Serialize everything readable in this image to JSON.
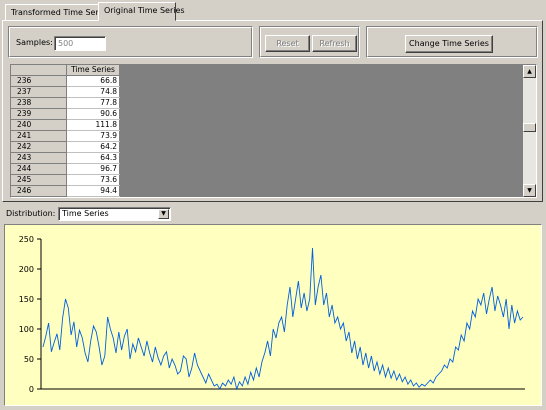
{
  "tabs": [
    {
      "label": "Transformed Time Series",
      "active": false
    },
    {
      "label": "Original Time Series",
      "active": true
    }
  ],
  "samples": {
    "label": "Samples:",
    "value": "500"
  },
  "buttons": {
    "reset": "Reset",
    "refresh": "Refresh",
    "change": "Change Time Series"
  },
  "grid": {
    "column_header": "Time Series",
    "rows": [
      {
        "index": "236",
        "value": "66.8"
      },
      {
        "index": "237",
        "value": "74.8"
      },
      {
        "index": "238",
        "value": "77.8"
      },
      {
        "index": "239",
        "value": "90.6"
      },
      {
        "index": "240",
        "value": "111.8"
      },
      {
        "index": "241",
        "value": "73.9"
      },
      {
        "index": "242",
        "value": "64.2"
      },
      {
        "index": "243",
        "value": "64.3"
      },
      {
        "index": "244",
        "value": "96.7"
      },
      {
        "index": "245",
        "value": "73.6"
      },
      {
        "index": "246",
        "value": "94.4"
      }
    ]
  },
  "distribution": {
    "label": "Distribution:",
    "selected": "Time Series"
  },
  "chart_data": {
    "type": "line",
    "title": "",
    "xlabel": "",
    "ylabel": "",
    "ylim": [
      0,
      250
    ],
    "yticks": [
      "0",
      "50",
      "100",
      "150",
      "200",
      "250"
    ],
    "grid": false,
    "line_color": "#0060e0",
    "background": "#ffffc0",
    "series": [
      {
        "values": [
          70,
          88,
          110,
          62,
          78,
          92,
          65,
          118,
          150,
          135,
          90,
          112,
          70,
          98,
          85,
          60,
          45,
          80,
          105,
          95,
          70,
          40,
          55,
          120,
          100,
          85,
          60,
          95,
          65,
          88,
          100,
          50,
          75,
          62,
          85,
          70,
          55,
          80,
          60,
          45,
          70,
          52,
          40,
          55,
          62,
          35,
          50,
          40,
          25,
          30,
          55,
          50,
          20,
          35,
          60,
          40,
          30,
          20,
          10,
          25,
          15,
          5,
          8,
          0,
          10,
          5,
          15,
          8,
          20,
          0,
          12,
          5,
          20,
          8,
          28,
          15,
          35,
          20,
          45,
          60,
          80,
          55,
          100,
          85,
          110,
          120,
          95,
          140,
          170,
          120,
          150,
          180,
          135,
          160,
          130,
          150,
          235,
          140,
          170,
          190,
          140,
          160,
          120,
          140,
          110,
          120,
          100,
          110,
          80,
          95,
          60,
          80,
          50,
          70,
          40,
          60,
          35,
          55,
          30,
          45,
          25,
          40,
          20,
          35,
          18,
          30,
          15,
          25,
          12,
          20,
          8,
          15,
          5,
          10,
          3,
          8,
          5,
          10,
          15,
          10,
          20,
          25,
          30,
          40,
          35,
          50,
          45,
          70,
          65,
          90,
          80,
          110,
          100,
          130,
          120,
          150,
          140,
          160,
          125,
          150,
          170,
          130,
          155,
          140,
          120,
          150,
          100,
          140,
          110,
          130,
          115,
          120
        ]
      }
    ]
  }
}
